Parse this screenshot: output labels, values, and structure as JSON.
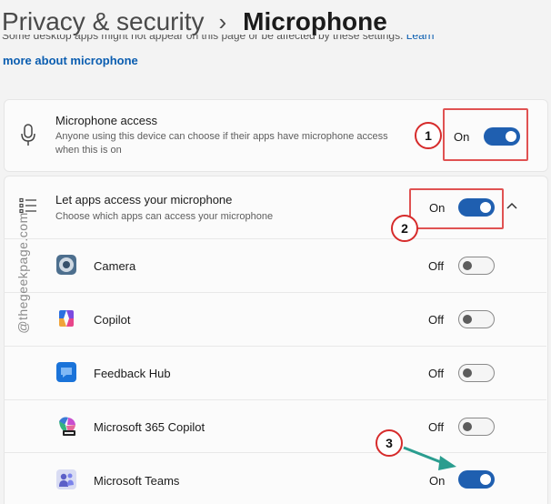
{
  "breadcrumb": {
    "parent": "Privacy & security",
    "separator": "›",
    "current": "Microphone"
  },
  "notice": {
    "text": "Some desktop apps might not appear on this page or be affected by these settings.",
    "link_tail": "Learn",
    "link": "more about microphone"
  },
  "microphone_access": {
    "title": "Microphone access",
    "description_line1": "Anyone using this device can choose if their apps have microphone access",
    "description_line2": "when this is on",
    "state": "On"
  },
  "let_apps": {
    "title": "Let apps access your microphone",
    "description": "Choose which apps can access your microphone",
    "state": "On",
    "chevron": "chevron-up-icon"
  },
  "apps": [
    {
      "name": "Camera",
      "state": "Off",
      "icon": "camera-icon"
    },
    {
      "name": "Copilot",
      "state": "Off",
      "icon": "copilot-icon"
    },
    {
      "name": "Feedback Hub",
      "state": "Off",
      "icon": "feedback-hub-icon"
    },
    {
      "name": "Microsoft 365 Copilot",
      "state": "Off",
      "icon": "m365-copilot-icon"
    },
    {
      "name": "Microsoft Teams",
      "state": "On",
      "icon": "teams-icon"
    }
  ],
  "annotations": {
    "badge1": "1",
    "badge2": "2",
    "badge3": "3"
  },
  "watermark": "@thegeekpage.com",
  "colors": {
    "accent": "#1f5fb0",
    "annotation_red": "#e05252",
    "arrow": "#2a9d8f",
    "link": "#0a5db0"
  }
}
